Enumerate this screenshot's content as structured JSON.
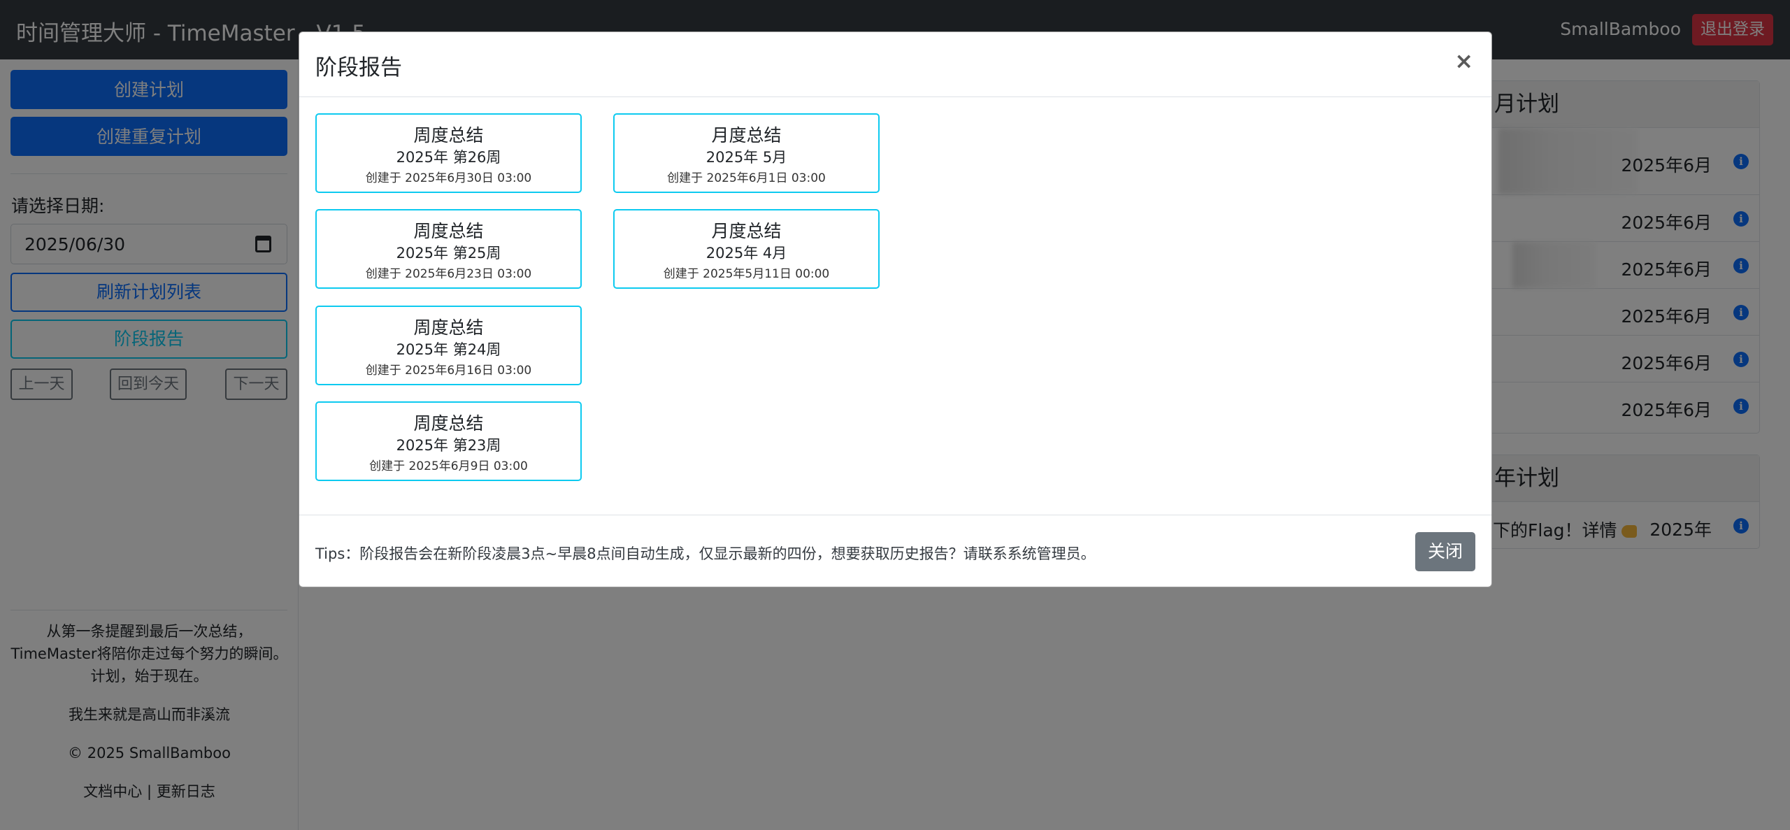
{
  "navbar": {
    "title": "时间管理大师 - TimeMaster - V1.5",
    "username": "SmallBamboo",
    "logout_label": "退出登录"
  },
  "sidebar": {
    "create_plan_label": "创建计划",
    "create_repeat_plan_label": "创建重复计划",
    "date_label": "请选择日期:",
    "date_value": "2025/06/30",
    "refresh_label": "刷新计划列表",
    "report_label": "阶段报告",
    "prev_day_label": "上一天",
    "today_label": "回到今天",
    "next_day_label": "下一天",
    "footer": {
      "line1": "从第一条提醒到最后一次总结，",
      "line2": "TimeMaster将陪你走过每个努力的瞬间。",
      "line3": "计划，始于现在。",
      "motto": "我生来就是高山而非溪流",
      "copyright": "© 2025 SmallBamboo",
      "docs_link": "文档中心",
      "separator": "|",
      "changelog_link": "更新日志"
    }
  },
  "month_plans": {
    "title": "月计划",
    "rows": [
      {
        "date": "2025年6月"
      },
      {
        "date": "2025年6月"
      },
      {
        "date": "2025年6月"
      },
      {
        "date": "2025年6月"
      },
      {
        "date": "2025年6月"
      },
      {
        "date": "2025年6月"
      }
    ]
  },
  "year_plans": {
    "title": "年计划",
    "rows": [
      {
        "text": "下的Flag！详情",
        "date": "2025年"
      }
    ]
  },
  "modal": {
    "title": "阶段报告",
    "close_x": "×",
    "reports": [
      {
        "title": "周度总结",
        "period": "2025年 第26周",
        "created": "创建于 2025年6月30日 03:00"
      },
      {
        "title": "月度总结",
        "period": "2025年 5月",
        "created": "创建于 2025年6月1日 03:00"
      },
      {
        "title": "周度总结",
        "period": "2025年 第25周",
        "created": "创建于 2025年6月23日 03:00"
      },
      {
        "title": "月度总结",
        "period": "2025年 4月",
        "created": "创建于 2025年5月11日 00:00"
      },
      {
        "title": "周度总结",
        "period": "2025年 第24周",
        "created": "创建于 2025年6月16日 03:00"
      },
      {
        "title": "周度总结",
        "period": "2025年 第23周",
        "created": "创建于 2025年6月9日 03:00"
      }
    ],
    "tips": "Tips：阶段报告会在新阶段凌晨3点~早晨8点间自动生成，仅显示最新的四份，想要获取历史报告？请联系系统管理员。",
    "close_label": "关闭"
  },
  "colors": {
    "navbar": "#343a40",
    "primary": "#0d6efd",
    "info": "#0dcaf0",
    "danger": "#dc3545",
    "secondary": "#6c757d"
  }
}
